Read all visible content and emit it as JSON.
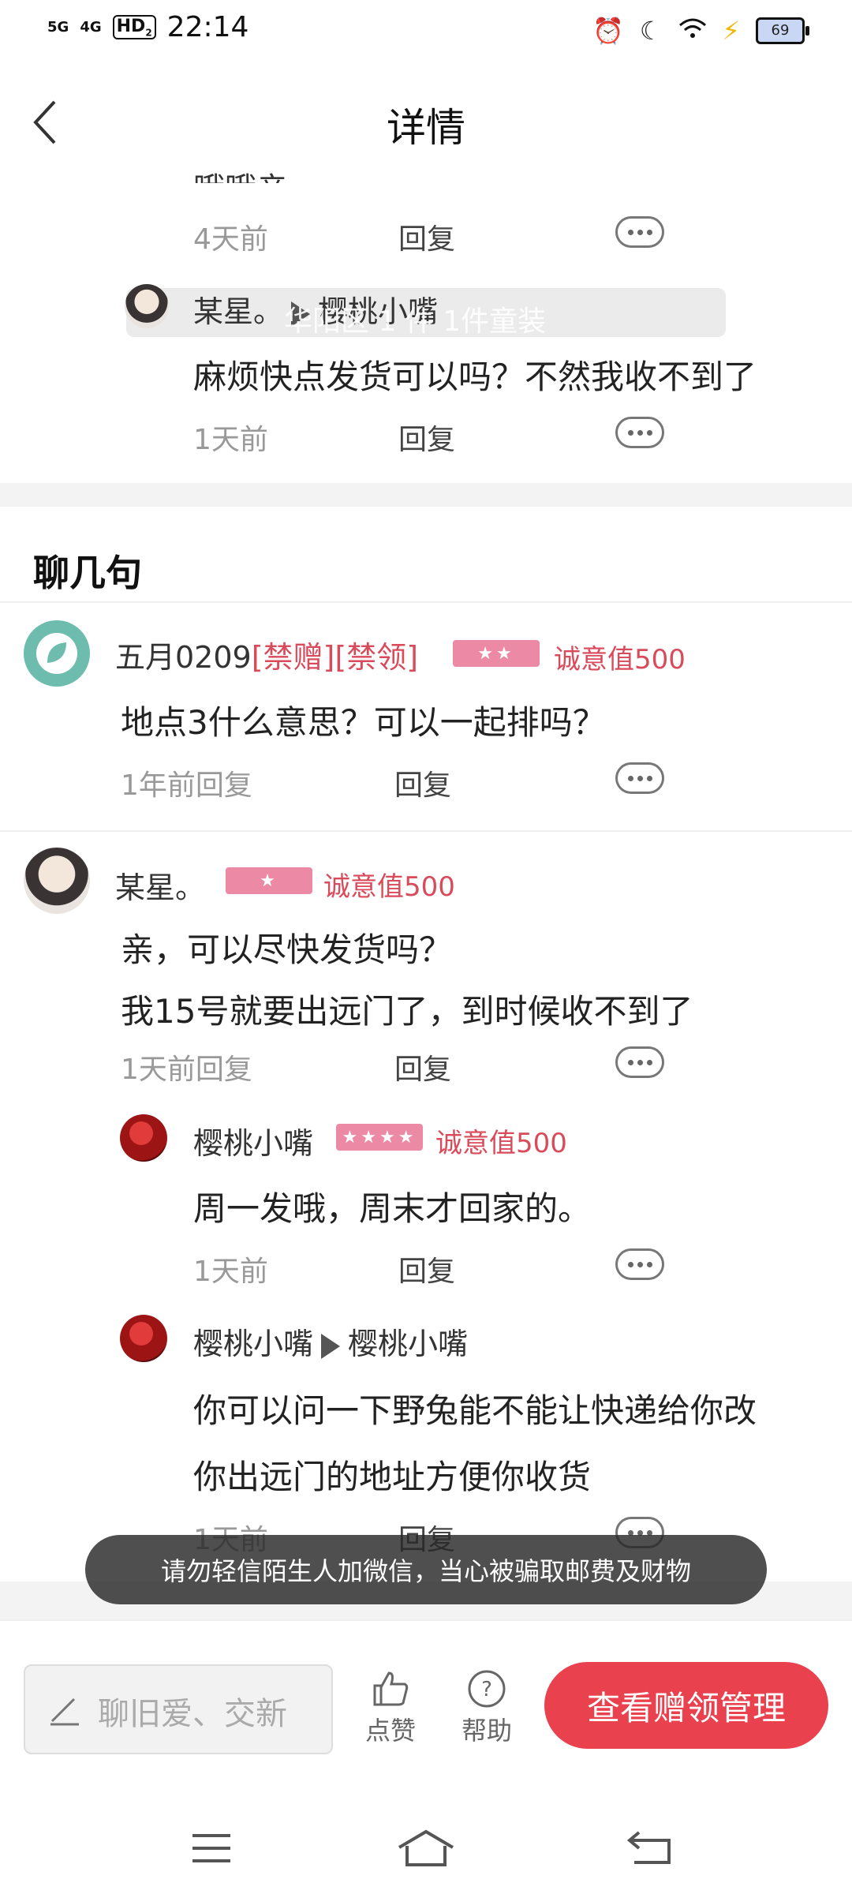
{
  "status_bar": {
    "signal1": "5G",
    "signal2": "4G",
    "hd": "HD",
    "hd_sub": "2",
    "time": "22:14",
    "battery": "69"
  },
  "header": {
    "title": "详情"
  },
  "clipped_text": "哦哦亲。",
  "marquee": {
    "watermark": "华阳区 1 件 1件童装"
  },
  "thread1": {
    "top_meta": {
      "time": "4天前",
      "reply": "回复"
    },
    "reply": {
      "user": "某星。",
      "to_user": "樱桃小嘴",
      "text": "麻烦快点发货可以吗？不然我收不到了",
      "time": "1天前",
      "reply_label": "回复"
    }
  },
  "section": {
    "title": "聊几句"
  },
  "comment1": {
    "user": "五月0209",
    "tag1": "[禁赠]",
    "tag2": "[禁领]",
    "badge_stars": "★★",
    "sincere": "诚意值500",
    "text": "地点3什么意思？可以一起排吗？",
    "time": "1年前回复",
    "reply_label": "回复"
  },
  "comment2": {
    "user": "某星。",
    "badge_stars": "★",
    "sincere": "诚意值500",
    "text_line1": "亲，可以尽快发货吗？",
    "text_line2": "我15号就要出远门了，到时候收不到了",
    "time": "1天前回复",
    "reply_label": "回复",
    "replies": [
      {
        "user": "樱桃小嘴",
        "badge_stars": "★★★★",
        "sincere": "诚意值500",
        "text": "周一发哦，周末才回家的。",
        "time": "1天前",
        "reply_label": "回复"
      },
      {
        "user": "樱桃小嘴",
        "to_user": "樱桃小嘴",
        "text_line1": "你可以问一下野兔能不能让快递给你改",
        "text_line2": "你出远门的地址方便你收货",
        "time": "1天前",
        "reply_label": "回复"
      }
    ]
  },
  "toast": "请勿轻信陌生人加微信，当心被骗取邮费及财物",
  "bottom_bar": {
    "input_placeholder": "聊旧爱、交新",
    "like_label": "点赞",
    "help_label": "帮助",
    "primary_button": "查看赠领管理"
  },
  "colors": {
    "accent": "#e9414e",
    "tag_red": "#d94a5a",
    "badge_pink": "#ec8aa5"
  },
  "icons": [
    "back-arrow-icon",
    "more-icon",
    "thumbs-up-icon",
    "help-icon",
    "pen-icon",
    "menu-icon",
    "home-icon",
    "return-icon",
    "alarm-icon",
    "moon-icon",
    "wifi-icon",
    "charging-icon"
  ]
}
